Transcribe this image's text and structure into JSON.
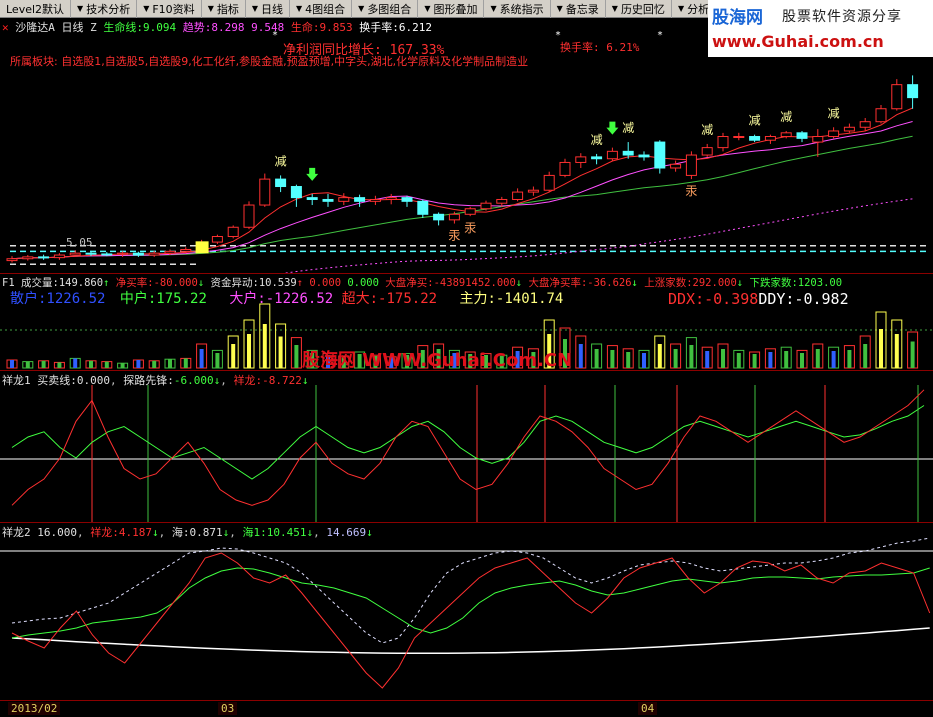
{
  "toolbar": {
    "items": [
      "Level2默认",
      "技术分析",
      "F10资料",
      "指标",
      "日线",
      "4图组合",
      "多图组合",
      "图形叠加",
      "系统指示",
      "备忘录",
      "历史回忆",
      "分析"
    ]
  },
  "logo": {
    "name": "股海网",
    "slogan": "股票软件资源分享",
    "url": "www.Guhai.com.cn"
  },
  "main_pane": {
    "title_row": {
      "icon": "close-icon",
      "stock": "沙隆达A",
      "period": "日线",
      "mode": "Z",
      "life_label": "生命线:",
      "life_value": "9.094",
      "trend_label": "趋势:",
      "trend_value": "8.298",
      "v3": "9.548",
      "life2_label": "生命:",
      "life2_value": "9.853",
      "turnover_label": "换手率:",
      "turnover_value": "6.212"
    },
    "annot_profit": "净利润同比增长: 167.33%",
    "annot_turnover": "换手率: 6.21%",
    "sector": "所属板块: 自选股1,自选股5,自选股9,化工化纤,参股金融,预盈预增,中字头,湖北,化学原料及化学制品制造业",
    "low_price": "5.05",
    "markers": {
      "reduce": "减",
      "hold": "汞"
    }
  },
  "volume_pane": {
    "title_row": {
      "f1": "F1",
      "vol_label": "成交量:",
      "vol_value": "149.860",
      "net_buy_label": "净买率:",
      "net_buy_value": "-80.000",
      "fund_label": "资金异动:",
      "fund_value": "10.539",
      "v1": "0.000",
      "v2": "0.000",
      "big_net_label": "大盘净买:",
      "big_net_value": "-43891452.000",
      "big_rate_label": "大盘净买率:",
      "big_rate_value": "-36.626",
      "up_label": "上涨家数:",
      "up_value": "292.000",
      "down_label": "下跌家数:",
      "down_value": "1203.00"
    },
    "big_row": {
      "retail": "散户:1226.52",
      "mid": "中户:175.22",
      "large": "大户:-1226.52",
      "super": "超大:-175.22",
      "main": "主力:-1401.74",
      "ddx": "DDX:-0.398",
      "ddy": "DDY:-0.982"
    }
  },
  "watermark": "股海网 WWW.Guhai.Com.CN",
  "xl1_pane": {
    "title_row": {
      "name": "祥龙1",
      "buy_label": "买卖线:",
      "buy_value": "0.000",
      "probe_label": "探路先锋:",
      "probe_value": "-6.000",
      "xl_label": "祥龙:",
      "xl_value": "-8.722"
    }
  },
  "xl2_pane": {
    "title_row": {
      "name": "祥龙2",
      "v0": "16.000",
      "xl_label": "祥龙:",
      "xl_value": "4.187",
      "sea_label": "海:",
      "sea_value": "0.871",
      "sea1_label": "海1:",
      "sea1_value": "10.451",
      "v5": "14.669"
    }
  },
  "dates": {
    "d1": "2013/02",
    "d2": "03",
    "d3": "04"
  },
  "colors": {
    "up": "#ff3030",
    "down": "#54ffff",
    "life": "#ff50ff",
    "ma_green": "#40c040",
    "yellow": "#ffff50"
  },
  "chart_data": {
    "type": "candlestick",
    "title": "沙隆达A 日线",
    "price_high_recent": "9.853",
    "price_low_marker": "5.05",
    "candles": [
      {
        "o": 5.1,
        "c": 5.15,
        "h": 5.22,
        "l": 5.05
      },
      {
        "o": 5.15,
        "c": 5.2,
        "h": 5.25,
        "l": 5.1
      },
      {
        "o": 5.2,
        "c": 5.18,
        "h": 5.26,
        "l": 5.12
      },
      {
        "o": 5.18,
        "c": 5.25,
        "h": 5.3,
        "l": 5.12
      },
      {
        "o": 5.25,
        "c": 5.3,
        "h": 5.38,
        "l": 5.2
      },
      {
        "o": 5.3,
        "c": 5.28,
        "h": 5.35,
        "l": 5.22
      },
      {
        "o": 5.28,
        "c": 5.27,
        "h": 5.33,
        "l": 5.22
      },
      {
        "o": 5.27,
        "c": 5.3,
        "h": 5.35,
        "l": 5.2
      },
      {
        "o": 5.3,
        "c": 5.25,
        "h": 5.34,
        "l": 5.2
      },
      {
        "o": 5.25,
        "c": 5.3,
        "h": 5.36,
        "l": 5.2
      },
      {
        "o": 5.3,
        "c": 5.35,
        "h": 5.4,
        "l": 5.25
      },
      {
        "o": 5.35,
        "c": 5.4,
        "h": 5.46,
        "l": 5.3
      },
      {
        "o": 5.4,
        "c": 5.6,
        "h": 5.66,
        "l": 5.38
      },
      {
        "o": 5.6,
        "c": 5.75,
        "h": 5.8,
        "l": 5.55
      },
      {
        "o": 5.75,
        "c": 6.0,
        "h": 6.05,
        "l": 5.7
      },
      {
        "o": 6.0,
        "c": 6.6,
        "h": 6.7,
        "l": 5.95
      },
      {
        "o": 6.6,
        "c": 7.3,
        "h": 7.45,
        "l": 6.55
      },
      {
        "o": 7.3,
        "c": 7.1,
        "h": 7.4,
        "l": 6.95
      },
      {
        "o": 7.1,
        "c": 6.8,
        "h": 7.15,
        "l": 6.55
      },
      {
        "o": 6.8,
        "c": 6.75,
        "h": 6.9,
        "l": 6.6
      },
      {
        "o": 6.75,
        "c": 6.7,
        "h": 6.9,
        "l": 6.55
      },
      {
        "o": 6.7,
        "c": 6.8,
        "h": 6.92,
        "l": 6.6
      },
      {
        "o": 6.8,
        "c": 6.7,
        "h": 6.88,
        "l": 6.55
      },
      {
        "o": 6.7,
        "c": 6.75,
        "h": 6.85,
        "l": 6.6
      },
      {
        "o": 6.75,
        "c": 6.8,
        "h": 6.9,
        "l": 6.62
      },
      {
        "o": 6.8,
        "c": 6.7,
        "h": 6.85,
        "l": 6.55
      },
      {
        "o": 6.7,
        "c": 6.35,
        "h": 6.75,
        "l": 6.25
      },
      {
        "o": 6.35,
        "c": 6.2,
        "h": 6.4,
        "l": 6.05
      },
      {
        "o": 6.2,
        "c": 6.35,
        "h": 6.42,
        "l": 6.1
      },
      {
        "o": 6.35,
        "c": 6.5,
        "h": 6.55,
        "l": 6.3
      },
      {
        "o": 6.5,
        "c": 6.65,
        "h": 6.72,
        "l": 6.45
      },
      {
        "o": 6.65,
        "c": 6.75,
        "h": 6.82,
        "l": 6.55
      },
      {
        "o": 6.75,
        "c": 6.95,
        "h": 7.05,
        "l": 6.7
      },
      {
        "o": 6.95,
        "c": 7.0,
        "h": 7.1,
        "l": 6.85
      },
      {
        "o": 7.0,
        "c": 7.4,
        "h": 7.5,
        "l": 6.95
      },
      {
        "o": 7.4,
        "c": 7.75,
        "h": 7.85,
        "l": 7.35
      },
      {
        "o": 7.75,
        "c": 7.9,
        "h": 8.0,
        "l": 7.6
      },
      {
        "o": 7.9,
        "c": 7.85,
        "h": 7.98,
        "l": 7.7
      },
      {
        "o": 7.85,
        "c": 8.05,
        "h": 8.15,
        "l": 7.8
      },
      {
        "o": 8.05,
        "c": 7.95,
        "h": 8.3,
        "l": 7.85
      },
      {
        "o": 7.95,
        "c": 7.9,
        "h": 8.05,
        "l": 7.8
      },
      {
        "o": 8.3,
        "c": 7.6,
        "h": 8.35,
        "l": 7.45
      },
      {
        "o": 7.6,
        "c": 7.7,
        "h": 7.8,
        "l": 7.5
      },
      {
        "o": 7.4,
        "c": 7.95,
        "h": 8.05,
        "l": 7.3
      },
      {
        "o": 7.95,
        "c": 8.15,
        "h": 8.25,
        "l": 7.9
      },
      {
        "o": 8.15,
        "c": 8.45,
        "h": 8.55,
        "l": 8.05
      },
      {
        "o": 8.45,
        "c": 8.45,
        "h": 8.55,
        "l": 8.35
      },
      {
        "o": 8.45,
        "c": 8.35,
        "h": 8.5,
        "l": 8.3
      },
      {
        "o": 8.35,
        "c": 8.45,
        "h": 8.5,
        "l": 8.25
      },
      {
        "o": 8.45,
        "c": 8.55,
        "h": 8.6,
        "l": 8.4
      },
      {
        "o": 8.55,
        "c": 8.4,
        "h": 8.6,
        "l": 8.3
      },
      {
        "o": 8.3,
        "c": 8.45,
        "h": 8.65,
        "l": 7.9
      },
      {
        "o": 8.45,
        "c": 8.6,
        "h": 8.7,
        "l": 8.4
      },
      {
        "o": 8.6,
        "c": 8.7,
        "h": 8.8,
        "l": 8.55
      },
      {
        "o": 8.7,
        "c": 8.85,
        "h": 8.95,
        "l": 8.6
      },
      {
        "o": 8.85,
        "c": 9.2,
        "h": 9.3,
        "l": 8.8
      },
      {
        "o": 9.2,
        "c": 9.85,
        "h": 10.0,
        "l": 9.15
      },
      {
        "o": 9.85,
        "c": 9.5,
        "h": 10.1,
        "l": 9.2
      }
    ]
  }
}
